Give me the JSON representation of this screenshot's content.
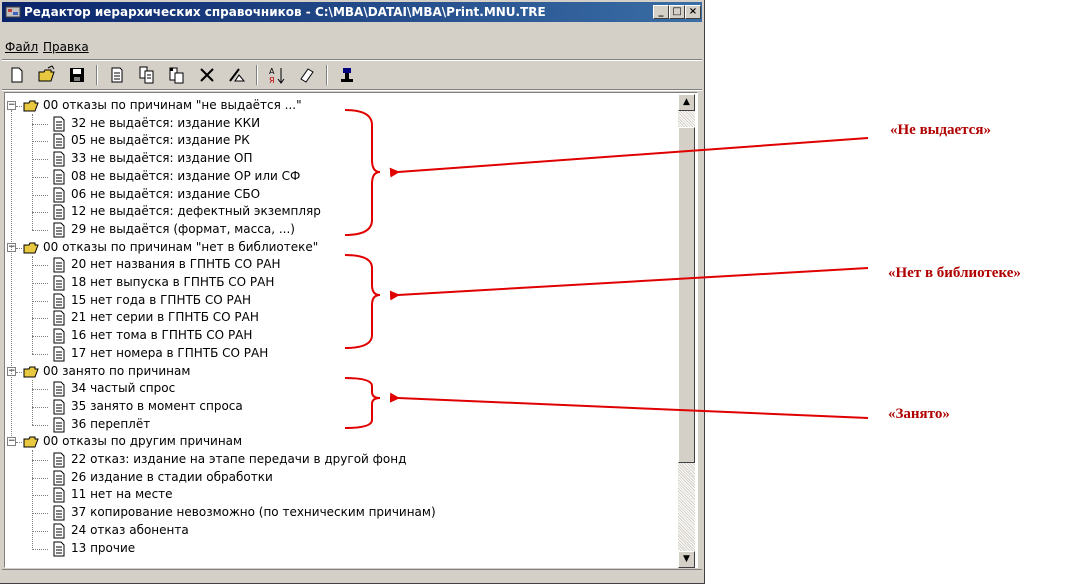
{
  "window": {
    "title": "Редактор иерархических справочников - C:\\MBA\\DATAI\\MBA\\Print.MNU.TRE",
    "controls": [
      "_",
      "□",
      "×"
    ]
  },
  "menu": [
    {
      "label": "Файл"
    },
    {
      "label": "Правка"
    }
  ],
  "toolbar": {
    "buttons": [
      "new-file-icon",
      "open-folder-icon",
      "save-disk-icon",
      "page-icon",
      "copy-pages-icon",
      "paste-icon",
      "delete-x-icon",
      "edit-wand-icon",
      "sort-az-icon",
      "eraser-icon",
      "tree-tool-icon"
    ]
  },
  "tree": {
    "groups": [
      {
        "label": "00 отказы по причинам \"не выдаётся ...\"",
        "items": [
          "32 не выдаётся: издание ККИ",
          "05 не выдаётся: издание РК",
          "33 не выдаётся: издание ОП",
          "08 не выдаётся: издание ОР или СФ",
          "06 не выдаётся: издание СБО",
          "12 не выдаётся: дефектный экземпляр",
          "29 не выдаётся (формат, масса, ...)"
        ]
      },
      {
        "label": "00 отказы по причинам \"нет в библиотеке\"",
        "items": [
          "20 нет названия в ГПНТБ СО РАН",
          "18 нет выпуска в ГПНТБ СО РАН",
          "15 нет года в ГПНТБ СО РАН",
          "21 нет серии в ГПНТБ СО РАН",
          "16 нет тома в ГПНТБ СО РАН",
          "17 нет номера в ГПНТБ СО РАН"
        ]
      },
      {
        "label": "00 занято по причинам",
        "items": [
          "34 частый спрос",
          "35 занято в момент спроса",
          "36 переплёт"
        ]
      },
      {
        "label": "00 отказы по другим причинам",
        "items": [
          "22 отказ: издание на этапе передачи в другой фонд",
          "26 издание в стадии обработки",
          "11 нет на месте",
          "37 копирование невозможно (по техническим причинам)",
          "24 отказ абонента",
          "13 прочие"
        ]
      }
    ]
  },
  "annotations": [
    {
      "text": "«Не выдается»"
    },
    {
      "text": "«Нет в библиотеке»"
    },
    {
      "text": "«Занято»"
    }
  ],
  "colors": {
    "title_bar_start": "#0a246a",
    "title_bar_end": "#3a6ea5",
    "annotation": "#b00000",
    "folder": "#e8c840"
  }
}
